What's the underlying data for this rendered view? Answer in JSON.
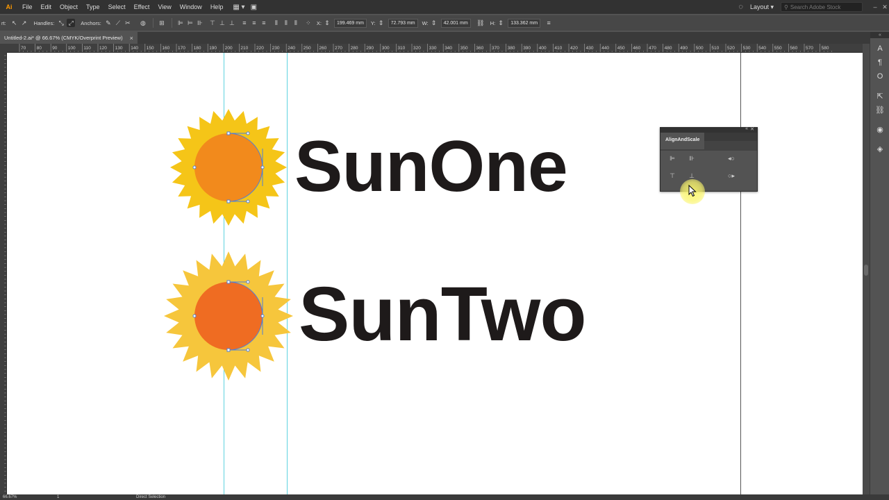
{
  "menubar": {
    "logo": "Ai",
    "items": [
      "File",
      "Edit",
      "Object",
      "Type",
      "Select",
      "Effect",
      "View",
      "Window",
      "Help"
    ],
    "layout_label": "Layout",
    "search_placeholder": "Search Adobe Stock"
  },
  "controlbar": {
    "handles_label": "Handles:",
    "anchors_label": "Anchors:",
    "x_label": "X:",
    "x_value": "199.469 mm",
    "y_label": "Y:",
    "y_value": "72.793 mm",
    "w_label": "W:",
    "w_value": "42.001 mm",
    "h_label": "H:",
    "h_value": "133.362 mm"
  },
  "document_tab": {
    "title": "Untitled-2.ai* @ 66.67% (CMYK/Overprint Preview)",
    "close": "×"
  },
  "ruler": {
    "h_ticks": [
      "70",
      "80",
      "90",
      "100",
      "110",
      "120",
      "130",
      "140",
      "150",
      "160",
      "170",
      "180",
      "190",
      "200",
      "210",
      "220",
      "230",
      "240",
      "250",
      "260",
      "270",
      "280",
      "290",
      "300",
      "310",
      "320",
      "330",
      "340",
      "350",
      "360",
      "370",
      "380",
      "390",
      "400",
      "410",
      "420",
      "430",
      "440",
      "450",
      "460",
      "470",
      "480",
      "490",
      "500",
      "510",
      "520",
      "530",
      "540",
      "550",
      "560",
      "570",
      "580"
    ]
  },
  "artwork": {
    "sun_one_text": "SunOne",
    "sun_two_text": "SunTwo",
    "colors": {
      "sun_one_rays": "#f5c518",
      "sun_one_core": "#f28a1c",
      "sun_two_rays": "#f6c63c",
      "sun_two_core": "#ef6c22",
      "guide": "#5ed3e0",
      "selection": "#4f7fd9",
      "text": "#1e1a1a"
    }
  },
  "align_panel": {
    "title": "AlignAndScale"
  },
  "statusbar": {
    "zoom": "66.67%",
    "artboard": "1",
    "tool": "Direct Selection"
  }
}
